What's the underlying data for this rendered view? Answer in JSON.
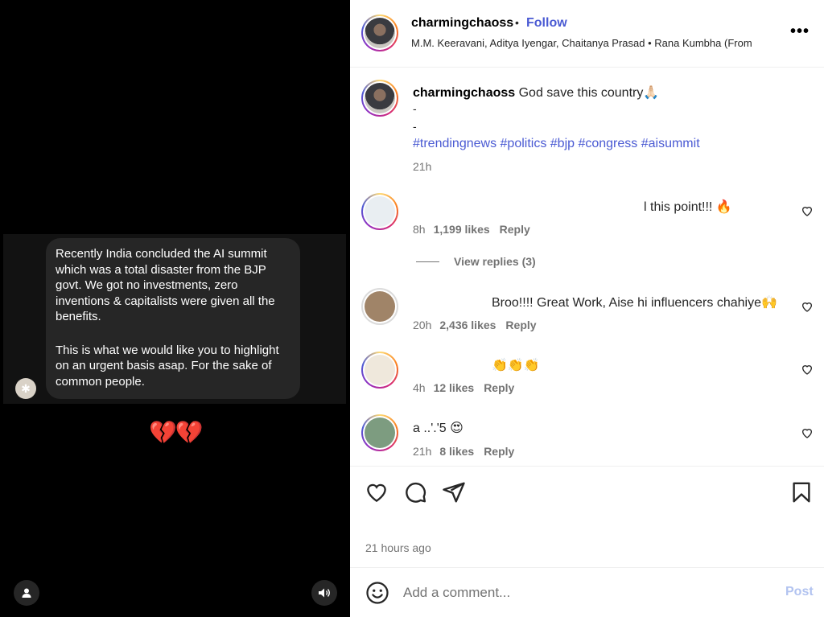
{
  "media": {
    "message_paragraph_1": "Recently India concluded the AI summit which was a total disaster from the BJP govt. We got no investments, zero inventions & capitalists were given all the benefits.",
    "message_paragraph_2": "This is what we would like you to highlight on an urgent basis asap. For the sake of common people.",
    "reaction_emoji": "💔💔",
    "user_icon": "user-icon",
    "sound_icon": "speaker-icon"
  },
  "header": {
    "username": "charmingchaoss",
    "separator": "•",
    "follow_label": "Follow",
    "audio": "M.M. Keeravani, Aditya Iyengar, Chaitanya Prasad • Rana Kumbha (From",
    "more_icon": "ellipsis-icon"
  },
  "caption": {
    "username": "charmingchaoss",
    "text": "God save this country🙏🏻",
    "line2": "-",
    "line3": "-",
    "hashtags": "#trendingnews #politics #bjp #congress #aisummit",
    "time": "21h"
  },
  "comments": [
    {
      "text": "l this point!!! 🔥",
      "time": "8h",
      "likes": "1,199 likes",
      "reply": "Reply"
    },
    {
      "text": "Broo!!!! Great Work, Aise hi influencers chahiye🙌",
      "time": "20h",
      "likes": "2,436 likes",
      "reply": "Reply"
    },
    {
      "text": "👏👏👏",
      "time": "4h",
      "likes": "12 likes",
      "reply": "Reply"
    },
    {
      "text": "a        ..'.'5 😍",
      "time": "21h",
      "likes": "8 likes",
      "reply": "Reply"
    }
  ],
  "view_replies": "View replies (3)",
  "actions": {
    "icons": [
      "heart-icon",
      "comment-icon",
      "share-icon",
      "bookmark-icon"
    ],
    "time_ago": "21 hours ago"
  },
  "comment_box": {
    "placeholder": "Add a comment...",
    "post_label": "Post",
    "emoji_icon": "emoji-icon"
  },
  "colors": {
    "link_blue": "#4a5ad3",
    "post_disabled": "#b2c3f0",
    "meta_gray": "#737373"
  }
}
